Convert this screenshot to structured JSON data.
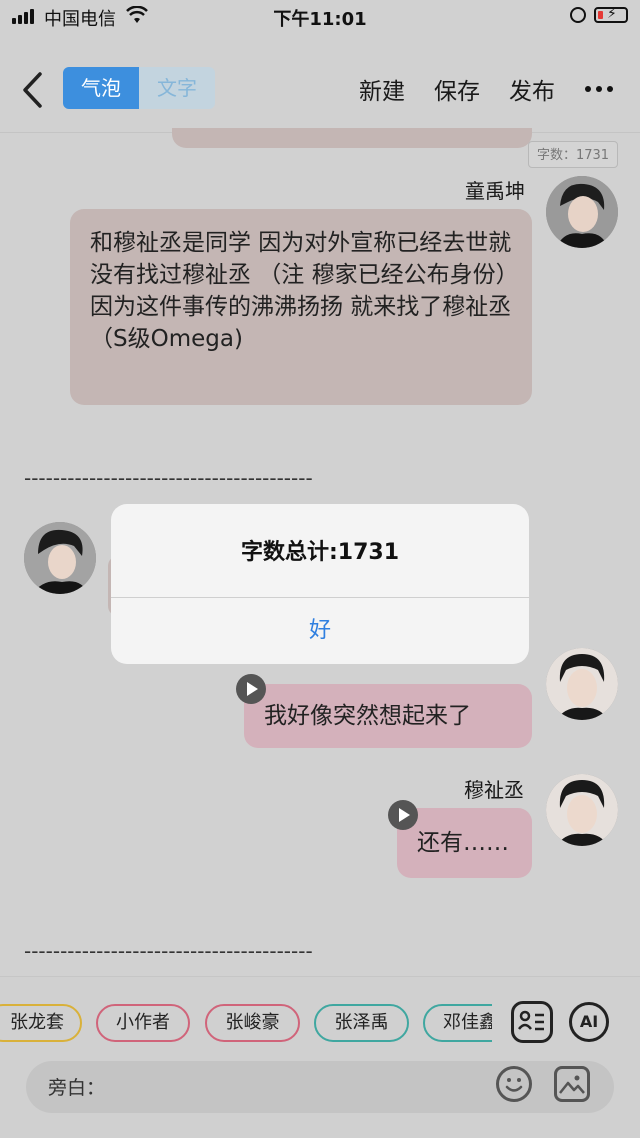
{
  "status_bar": {
    "carrier": "中国电信",
    "time": "下午11:01"
  },
  "nav": {
    "tabs": [
      {
        "label": "气泡",
        "active": true
      },
      {
        "label": "文字",
        "active": false
      }
    ],
    "new_label": "新建",
    "save_label": "保存",
    "publish_label": "发布"
  },
  "word_count_badge": "字数：1731",
  "messages": {
    "m1": {
      "speaker": "童禹坤",
      "text": "和穆祉丞是同学 因为对外宣称已经去世就没有找过穆祉丞 （注 穆家已经公布身份）因为这件事传的沸沸扬扬 就来找了穆祉丞（S级Omega)"
    },
    "divider1": "----------------------------------------",
    "m3": {
      "speaker": "穆祉丞",
      "text": "我好像突然想起来了"
    },
    "m4": {
      "speaker": "穆祉丞",
      "text": "还有……"
    },
    "divider2": "----------------------------------------"
  },
  "alert": {
    "title": "字数总计:1731",
    "ok_label": "好"
  },
  "characters": [
    {
      "label": "张龙套",
      "color": "#d9b13a"
    },
    {
      "label": "小作者",
      "color": "#d0647a"
    },
    {
      "label": "张峻豪",
      "color": "#d0647a"
    },
    {
      "label": "张泽禹",
      "color": "#3fa7a0"
    },
    {
      "label": "邓佳鑫",
      "color": "#3fa7a0"
    }
  ],
  "ai_label": "AI",
  "input": {
    "placeholder": "旁白："
  },
  "icons": [
    "back-icon",
    "more-icon",
    "play-icon",
    "contacts-icon",
    "emoji-icon",
    "image-icon",
    "wifi-icon",
    "battery-icon"
  ]
}
